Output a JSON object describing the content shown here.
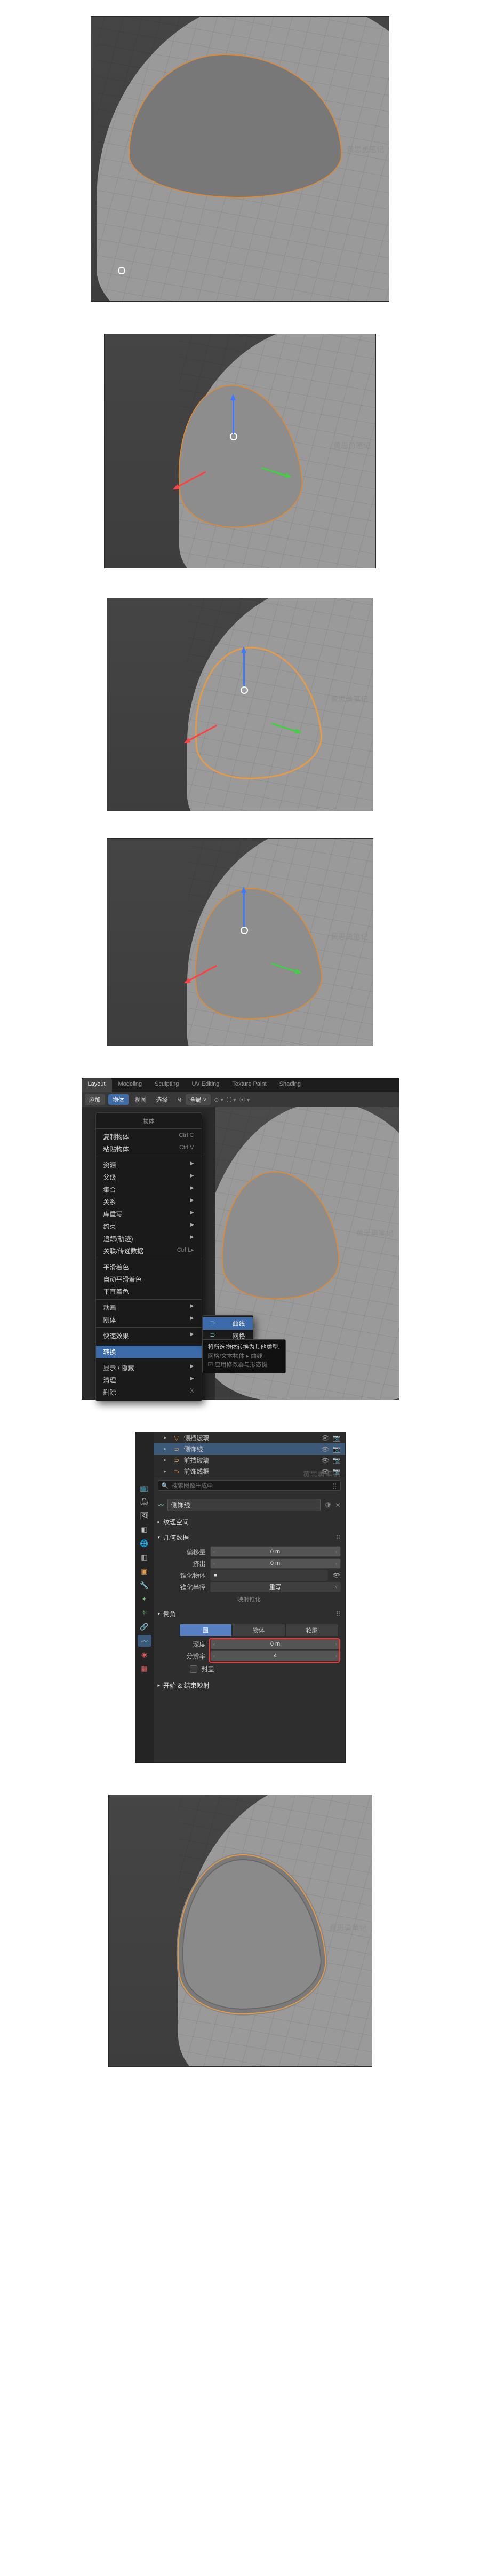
{
  "watermark": "黄思勇笔记",
  "block5": {
    "tabs": [
      "Layout",
      "Modeling",
      "Sculpting",
      "UV Editing",
      "Texture Paint",
      "Shading"
    ],
    "toolbar": {
      "add": "添加",
      "mode": "物体",
      "view": "视图",
      "select": "选择",
      "global": "全局"
    },
    "menu": [
      {
        "t": "header",
        "label": "物体"
      },
      {
        "t": "sep"
      },
      {
        "t": "item",
        "label": "复制物体",
        "shortcut": "Ctrl C"
      },
      {
        "t": "item",
        "label": "粘贴物体",
        "shortcut": "Ctrl V"
      },
      {
        "t": "sep"
      },
      {
        "t": "sub",
        "label": "资源"
      },
      {
        "t": "sub",
        "label": "父级"
      },
      {
        "t": "sub",
        "label": "集合"
      },
      {
        "t": "sub",
        "label": "关系"
      },
      {
        "t": "sub",
        "label": "库重写"
      },
      {
        "t": "sub",
        "label": "约束"
      },
      {
        "t": "sub",
        "label": "追踪(轨迹)"
      },
      {
        "t": "item",
        "label": "关联/传递数据",
        "shortcut": "Ctrl L▸"
      },
      {
        "t": "sep"
      },
      {
        "t": "item",
        "label": "平滑着色"
      },
      {
        "t": "item",
        "label": "自动平滑着色"
      },
      {
        "t": "item",
        "label": "平直着色"
      },
      {
        "t": "sep"
      },
      {
        "t": "sub",
        "label": "动画"
      },
      {
        "t": "sub",
        "label": "刚体"
      },
      {
        "t": "sep"
      },
      {
        "t": "sub",
        "label": "快速效果"
      },
      {
        "t": "sep"
      },
      {
        "t": "hl",
        "label": "转换"
      },
      {
        "t": "sep"
      },
      {
        "t": "sub",
        "label": "显示 / 隐藏"
      },
      {
        "t": "sub",
        "label": "清理"
      },
      {
        "t": "item",
        "label": "删除",
        "shortcut": "X"
      }
    ],
    "submenu": [
      {
        "label": "曲线",
        "hl": true
      },
      {
        "label": "网格"
      }
    ],
    "tooltip": {
      "line1": "将所选物体转换为其他类型.",
      "line2": "网格/文本物体 ▸ 曲线",
      "line3": "应用修改器与形态键"
    }
  },
  "block6": {
    "outliner": [
      {
        "icon": "▽",
        "color": "orange",
        "label": "侧挡玻璃",
        "sel": false
      },
      {
        "icon": "⊃",
        "color": "orange",
        "label": "侧饰线",
        "sel": true
      },
      {
        "icon": "⊃",
        "color": "orange",
        "label": "前挡玻璃",
        "sel": false
      },
      {
        "icon": "⊃",
        "color": "orange",
        "label": "前饰线框",
        "sel": false
      }
    ],
    "search_placeholder": "搜索图像生成中",
    "curve_name": "侧饰线",
    "sec_texspace": "纹理空间",
    "sec_geom": "几何数据",
    "fields": {
      "offset": {
        "label": "偏移量",
        "value": "0 m"
      },
      "extrude": {
        "label": "挤出",
        "value": "0 m"
      },
      "taper_obj": {
        "label": "锥化物体",
        "value": "■"
      },
      "taper_radius": {
        "label": "锥化半径",
        "value": "重写"
      }
    },
    "sec_bevel": "倒角",
    "bevel_segs": [
      "圆",
      "物体",
      "轮廓"
    ],
    "bevel": {
      "depth": {
        "label": "深度",
        "value": "0 m"
      },
      "resolution": {
        "label": "分辨率",
        "value": "4"
      },
      "fill_caps": {
        "label": "封盖",
        "checked": false
      }
    },
    "sec_start_end": "开始 & 结束映射"
  }
}
